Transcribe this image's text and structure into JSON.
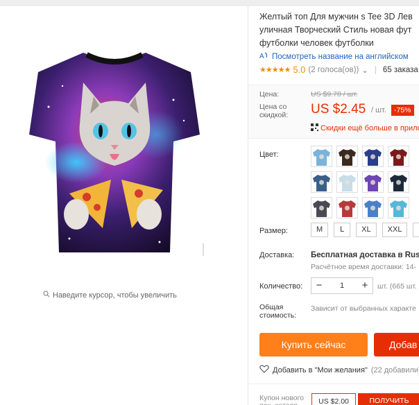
{
  "product": {
    "title_lines": [
      "Желтый топ Для мужчин s Tee 3D Лев",
      "уличная Творческий Стиль новая фут",
      "футболки человек футболки"
    ],
    "translate_link": "Посмотреть название на английском",
    "rating": "5.0",
    "stars": "★★★★★",
    "votes": "(2 голоса(ов))",
    "orders": "65 заказа"
  },
  "gallery": {
    "zoom_hint": "Наведите курсор, чтобы увеличить"
  },
  "price": {
    "label": "Цена:",
    "old": "US $9.78 / шт.",
    "discount_label": "Цена со скидкой:",
    "new": "US $2.45",
    "unit": "/ шт.",
    "discount": "-75%",
    "promo": "Скидки ещё больше в прило"
  },
  "color": {
    "label": "Цвет:",
    "swatches": [
      "#7ab3d9",
      "#3b2a1e",
      "#2a3e8c",
      "#7a1a1a",
      "#3a5f8a",
      "#c7dde8",
      "#6e45b3",
      "#1e2a3a",
      "#4a4a55",
      "#b73a3a",
      "#4c7fc9",
      "#57b7d6"
    ]
  },
  "size": {
    "label": "Размер:",
    "options": [
      "M",
      "L",
      "XL",
      "XXL",
      "X"
    ]
  },
  "shipping": {
    "label": "Доставка:",
    "value": "Бесплатная доставка в Russia",
    "time": "Расчётное время доставки: 14-"
  },
  "quantity": {
    "label": "Количество:",
    "minus": "−",
    "value": "1",
    "plus": "+",
    "available": "шт. (665 шт."
  },
  "total": {
    "label": "Общая стоимость:",
    "value": "Зависит от выбранных характе"
  },
  "actions": {
    "buy_now": "Купить сейчас",
    "add_to_cart": "Добав",
    "wishlist": "Добавить в \"Мои желания\"",
    "wishlist_count": "(22 добавили)"
  },
  "coupon": {
    "label": "Купон нового пок.-зателя",
    "amount": "US $2.00",
    "button": "ПОЛУЧИТЬ"
  },
  "colors": {
    "accent": "#e62e04",
    "buy": "#ff7f1a",
    "link": "#1a66c7",
    "star": "#f08c00"
  }
}
